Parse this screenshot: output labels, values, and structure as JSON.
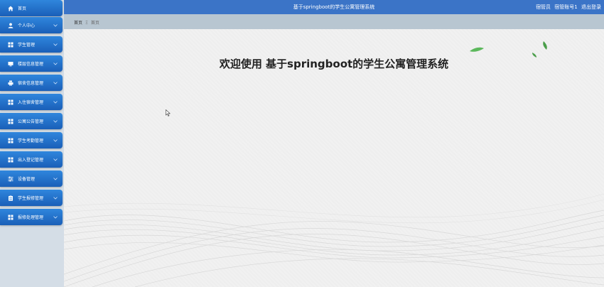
{
  "header": {
    "title": "基于springboot的学生公寓管理系统",
    "role": "宿管员",
    "account": "宿管账号1",
    "logout": "退出登录"
  },
  "breadcrumb": {
    "home": "首页",
    "separator": "Ξ",
    "current": "首页"
  },
  "main": {
    "welcome": "欢迎使用 基于springboot的学生公寓管理系统"
  },
  "sidebar": {
    "items": [
      {
        "label": "首页",
        "icon": "home-icon",
        "has_chevron": false
      },
      {
        "label": "个人中心",
        "icon": "user-icon",
        "has_chevron": true
      },
      {
        "label": "学生管理",
        "icon": "grid-icon",
        "has_chevron": true
      },
      {
        "label": "楼层信息管理",
        "icon": "monitor-icon",
        "has_chevron": true
      },
      {
        "label": "宿舍信息管理",
        "icon": "printer-icon",
        "has_chevron": true
      },
      {
        "label": "入住宿舍管理",
        "icon": "grid-icon",
        "has_chevron": true
      },
      {
        "label": "公寓公告管理",
        "icon": "grid-icon",
        "has_chevron": true
      },
      {
        "label": "学生考勤管理",
        "icon": "grid-icon",
        "has_chevron": true
      },
      {
        "label": "出入登记管理",
        "icon": "grid-icon",
        "has_chevron": true
      },
      {
        "label": "设备管理",
        "icon": "sliders-icon",
        "has_chevron": true
      },
      {
        "label": "学生报修管理",
        "icon": "clipboard-icon",
        "has_chevron": true
      },
      {
        "label": "报修处理管理",
        "icon": "grid-icon",
        "has_chevron": true
      }
    ]
  },
  "colors": {
    "sidebar_item": "#2477d3",
    "topbar": "#3b74c7",
    "breadcrumb_bar": "#b8c6d1",
    "sidebar_bg": "#d4dde6",
    "leaf": "#5cb85c"
  }
}
